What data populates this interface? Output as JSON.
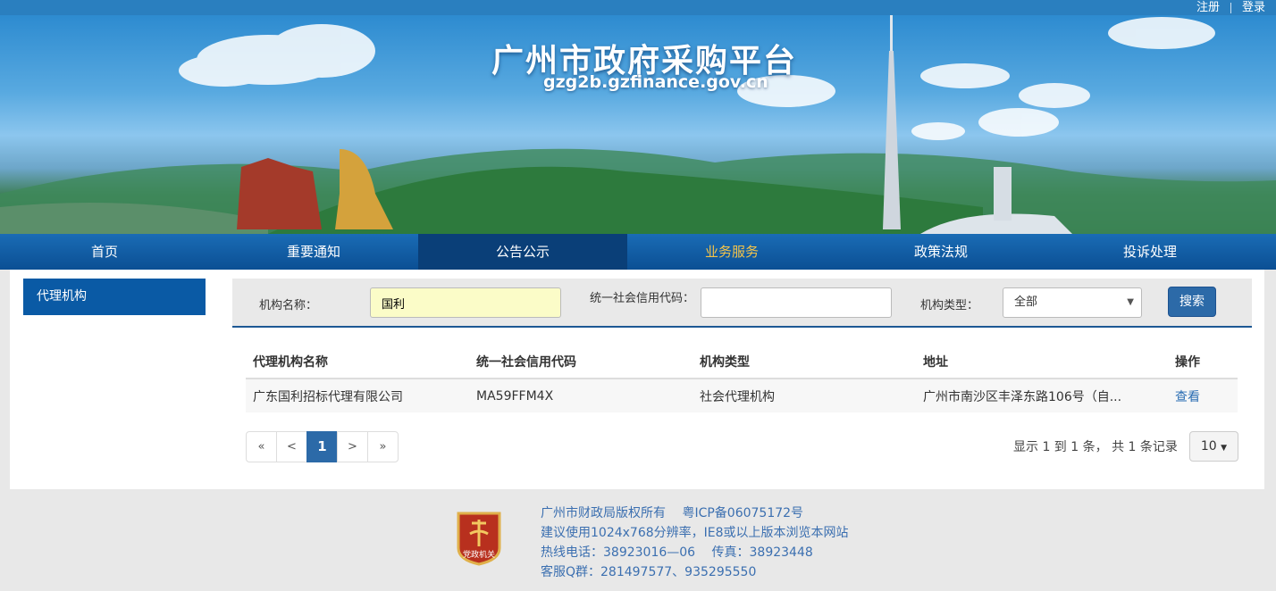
{
  "topbar": {
    "register": "注册",
    "login": "登录"
  },
  "banner": {
    "title": "广州市政府采购平台",
    "domain": "gzg2b.gzfinance.gov.cn"
  },
  "nav": [
    "首页",
    "重要通知",
    "公告公示",
    "业务服务",
    "政策法规",
    "投诉处理"
  ],
  "sidebar": {
    "item": "代理机构"
  },
  "search": {
    "name_label": "机构名称：",
    "name_value": "国利",
    "credit_label": "统一社会信用代码：",
    "credit_value": "",
    "type_label": "机构类型：",
    "type_selected": "全部",
    "button": "搜索"
  },
  "table": {
    "headers": [
      "代理机构名称",
      "统一社会信用代码",
      "机构类型",
      "地址",
      "操作"
    ],
    "rows": [
      [
        "广东国利招标代理有限公司",
        "MA59FFM4X",
        "社会代理机构",
        "广州市南沙区丰泽东路106号（自...",
        "查看"
      ]
    ]
  },
  "pagination": {
    "first": "«",
    "prev": "<",
    "current": "1",
    "next": ">",
    "last": "»",
    "info": "显示 1 到 1 条， 共 1 条记录",
    "page_size": "10"
  },
  "footer": {
    "badge_text": "党政机关",
    "lines": [
      "广州市财政局版权所有　 粤ICP备06075172号",
      "建议使用1024x768分辨率，IE8或以上版本浏览本网站",
      "热线电话：38923016—06　 传真：38923448",
      "客服Q群：281497577、935295550"
    ]
  },
  "colors": {
    "nav": "#0b4f94",
    "accent": "#2c6aa8",
    "link": "#2a6db3",
    "highlight_input": "#fbfcc8"
  }
}
